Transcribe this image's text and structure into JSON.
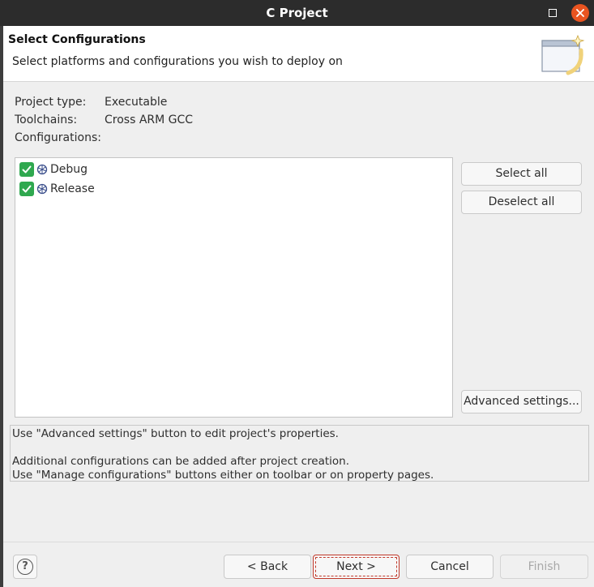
{
  "window": {
    "title": "C Project"
  },
  "header": {
    "title": "Select Configurations",
    "subtitle": "Select platforms and configurations you wish to deploy on"
  },
  "info": {
    "project_type_label": "Project type:",
    "project_type_value": "Executable",
    "toolchains_label": "Toolchains:",
    "toolchains_value": "Cross ARM GCC",
    "configurations_label": "Configurations:"
  },
  "configurations": [
    {
      "label": "Debug",
      "checked": true
    },
    {
      "label": "Release",
      "checked": true
    }
  ],
  "side_buttons": {
    "select_all": "Select all",
    "deselect_all": "Deselect all",
    "advanced": "Advanced settings..."
  },
  "help_text": {
    "line1": "Use \"Advanced settings\" button to edit project's properties.",
    "line2": "Additional configurations can be added after project creation.",
    "line3": "Use \"Manage configurations\" buttons either on toolbar or on property pages."
  },
  "footer": {
    "help_icon": "question-mark-icon",
    "back": "< Back",
    "next": "Next >",
    "cancel": "Cancel",
    "finish": "Finish"
  },
  "colors": {
    "titlebar": "#2c2c2c",
    "close_button": "#e95420",
    "checkbox": "#2fa84f"
  }
}
